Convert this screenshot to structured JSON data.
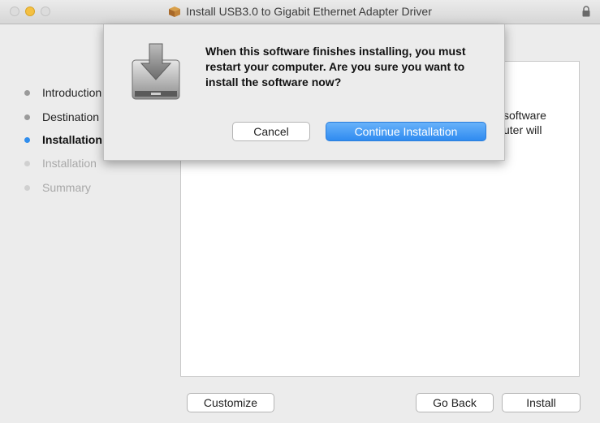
{
  "window": {
    "title": "Install USB3.0 to Gigabit Ethernet Adapter Driver",
    "icons": [
      "close-icon",
      "minimize-icon",
      "zoom-icon",
      "package-icon",
      "lock-icon"
    ],
    "accent_color": "#2f8ded"
  },
  "sidebar": {
    "items": [
      {
        "label": "Introduction",
        "state": "done"
      },
      {
        "label": "Destination",
        "state": "done"
      },
      {
        "label": "Installation",
        "state": "active"
      },
      {
        "label": "Installation",
        "state": "pending"
      },
      {
        "label": "Summary",
        "state": "pending"
      }
    ]
  },
  "content": {
    "partial_text_line1": "software",
    "partial_text_line2": "uter will"
  },
  "footer": {
    "customize_label": "Customize",
    "go_back_label": "Go Back",
    "install_label": "Install"
  },
  "sheet": {
    "message": "When this software finishes installing, you must restart your computer. Are you sure you want to install the software now?",
    "cancel_label": "Cancel",
    "continue_label": "Continue Installation",
    "icon": "installer-download-icon"
  }
}
